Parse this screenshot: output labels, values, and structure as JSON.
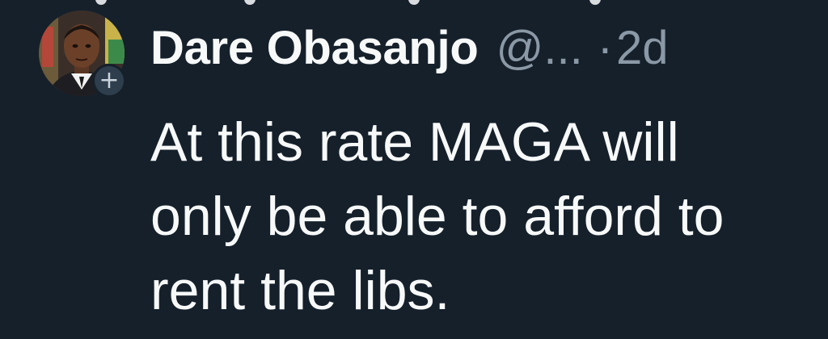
{
  "tweet": {
    "display_name": "Dare Obasanjo",
    "handle": "@...",
    "separator": "·",
    "time": "2d",
    "text_lines": [
      "At this rate MAGA will",
      "only be able to afford to",
      "rent the libs."
    ]
  },
  "avatar": {
    "follow_badge_symbol": "+"
  },
  "colors": {
    "background": "#15202b",
    "primary_text": "#f7f9f9",
    "secondary_text": "#8b98a5"
  }
}
